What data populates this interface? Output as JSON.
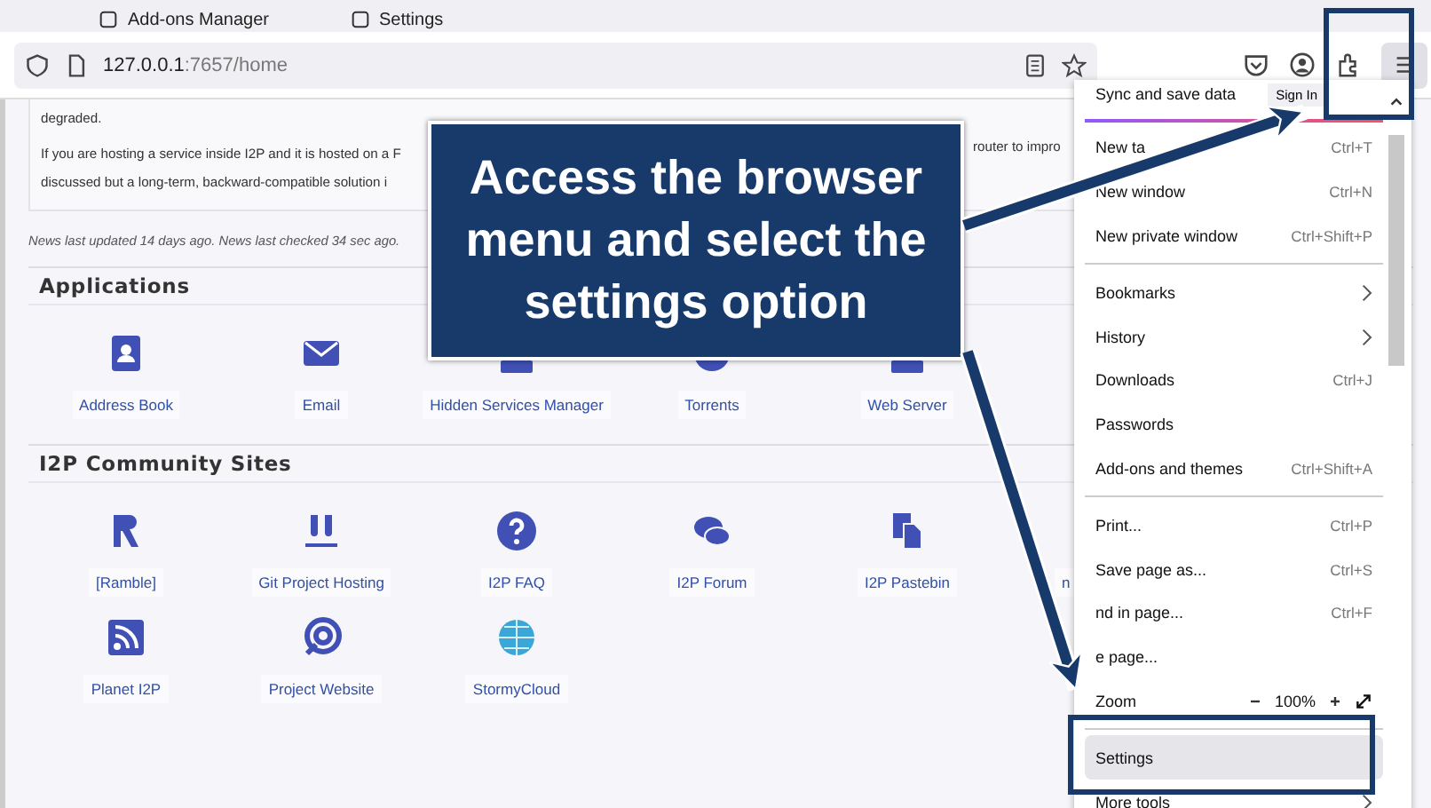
{
  "browser": {
    "tabs": [
      {
        "label": "Add-ons Manager",
        "selected": false
      },
      {
        "label": "Settings",
        "selected": false
      }
    ],
    "address": {
      "host": "127.0.0.1",
      "path": ":7657/home"
    }
  },
  "news": {
    "lines": [
      "degraded.",
      "If you are hosting a service inside I2P and it is hosted on a F",
      "discussed but a long-term, backward-compatible solution i"
    ],
    "right_fragment": "router to impro",
    "footer": "News last updated 14 days ago. News last checked 34 sec ago."
  },
  "sections": [
    {
      "title": "Applications",
      "items": [
        {
          "label": "Address Book"
        },
        {
          "label": "Email"
        },
        {
          "label": "Hidden Services Manager"
        },
        {
          "label": "Torrents"
        },
        {
          "label": "Web Server"
        }
      ]
    },
    {
      "title": "I2P Community Sites",
      "items": [
        {
          "label": "[Ramble]"
        },
        {
          "label": "Git Project Hosting"
        },
        {
          "label": "I2P FAQ"
        },
        {
          "label": "I2P Forum"
        },
        {
          "label": "I2P Pastebin"
        },
        {
          "label": "n"
        },
        {
          "label": "Planet I2P"
        },
        {
          "label": "Project Website"
        },
        {
          "label": "StormyCloud"
        }
      ]
    }
  ],
  "menu": {
    "sync": {
      "label": "Sync and save data",
      "button": "Sign In"
    },
    "items": [
      {
        "kind": "item",
        "label": "New ta",
        "shortcut": "Ctrl+T",
        "selected": false
      },
      {
        "kind": "item",
        "label": "New window",
        "shortcut": "Ctrl+N",
        "selected": false
      },
      {
        "kind": "item",
        "label": "New private window",
        "shortcut": "Ctrl+Shift+P",
        "selected": false
      },
      {
        "kind": "separator"
      },
      {
        "kind": "submenu",
        "label": "Bookmarks",
        "selected": false
      },
      {
        "kind": "submenu",
        "label": "History",
        "selected": false
      },
      {
        "kind": "item",
        "label": "Downloads",
        "shortcut": "Ctrl+J",
        "selected": false
      },
      {
        "kind": "item",
        "label": "Passwords",
        "selected": false
      },
      {
        "kind": "item",
        "label": "Add-ons and themes",
        "shortcut": "Ctrl+Shift+A",
        "selected": false
      },
      {
        "kind": "separator"
      },
      {
        "kind": "item",
        "label": "Print...",
        "shortcut": "Ctrl+P",
        "selected": false
      },
      {
        "kind": "item",
        "label": "Save page as...",
        "shortcut": "Ctrl+S",
        "selected": false
      },
      {
        "kind": "item",
        "label": "nd in page...",
        "shortcut": "Ctrl+F",
        "selected": false
      },
      {
        "kind": "item",
        "label": "e page...",
        "selected": false
      },
      {
        "kind": "zoom",
        "label": "Zoom",
        "value": "100%"
      },
      {
        "kind": "separator"
      },
      {
        "kind": "item",
        "label": "Settings",
        "selected": true
      },
      {
        "kind": "submenu",
        "label": "More tools",
        "selected": false
      }
    ]
  },
  "callout": {
    "lines": [
      "Access the browser",
      "menu and select the",
      "settings option"
    ]
  }
}
